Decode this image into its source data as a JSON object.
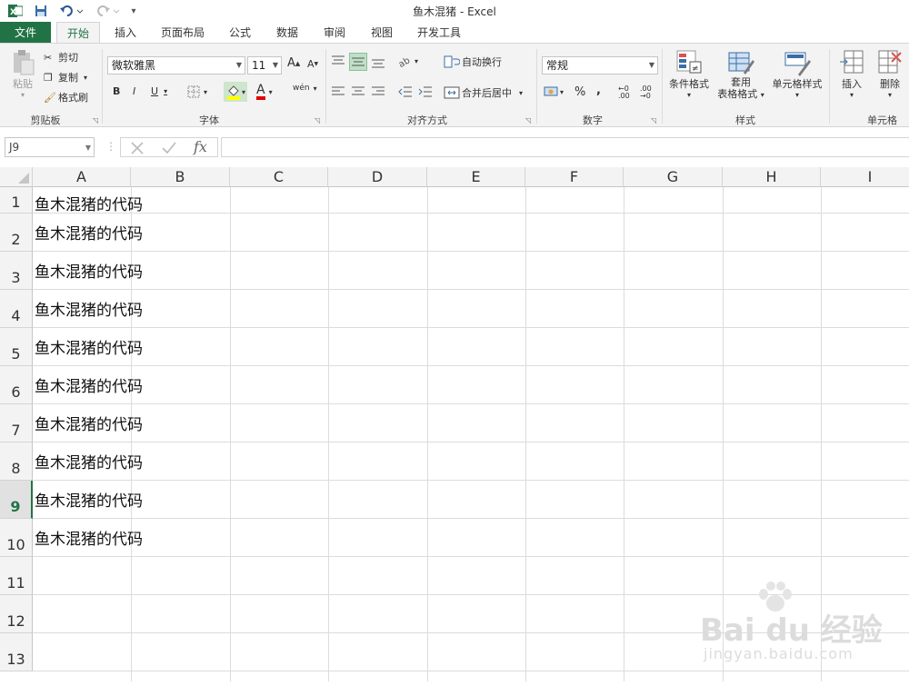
{
  "window": {
    "title": "鱼木混猪 - Excel"
  },
  "colors": {
    "excel_green": "#217346",
    "ribbon_bg": "#f3f3f3",
    "grid_line": "#dadcdd"
  },
  "tabs": [
    "文件",
    "开始",
    "插入",
    "页面布局",
    "公式",
    "数据",
    "审阅",
    "视图",
    "开发工具"
  ],
  "ribbon": {
    "clipboard": {
      "paste": "粘贴",
      "cut": "剪切",
      "copy": "复制",
      "format_painter": "格式刷",
      "label": "剪贴板"
    },
    "font": {
      "name": "微软雅黑",
      "size": "11",
      "grow": "A",
      "shrink": "A",
      "bold": "B",
      "italic": "I",
      "underline": "U",
      "font_color": "A",
      "phonetic": "wén",
      "label": "字体"
    },
    "alignment": {
      "wrap": "自动换行",
      "merge": "合并后居中",
      "label": "对齐方式"
    },
    "number": {
      "format": "常规",
      "percent": "%",
      "comma": ",",
      "inc": "←0 .00",
      "dec": ".00 →0",
      "label": "数字"
    },
    "styles": {
      "conditional": "条件格式",
      "table_line1": "套用",
      "table_line2": "表格格式",
      "cell_styles": "单元格样式",
      "label": "样式"
    },
    "cells": {
      "insert": "插入",
      "delete": "删除",
      "label": "单元格"
    }
  },
  "formula_bar": {
    "name_box": "J9",
    "fx": "fx",
    "value": ""
  },
  "columns": [
    "A",
    "B",
    "C",
    "D",
    "E",
    "F",
    "G",
    "H",
    "I"
  ],
  "rows": [
    "1",
    "2",
    "3",
    "4",
    "5",
    "6",
    "7",
    "8",
    "9",
    "10",
    "11",
    "12",
    "13"
  ],
  "active_row": "9",
  "cells": [
    "鱼木混猪的代码",
    "鱼木混猪的代码",
    "鱼木混猪的代码",
    "鱼木混猪的代码",
    "鱼木混猪的代码",
    "鱼木混猪的代码",
    "鱼木混猪的代码",
    "鱼木混猪的代码",
    "鱼木混猪的代码",
    "鱼木混猪的代码"
  ],
  "watermark": {
    "brand": "Bai du 经验",
    "url": "jingyan.baidu.com"
  }
}
